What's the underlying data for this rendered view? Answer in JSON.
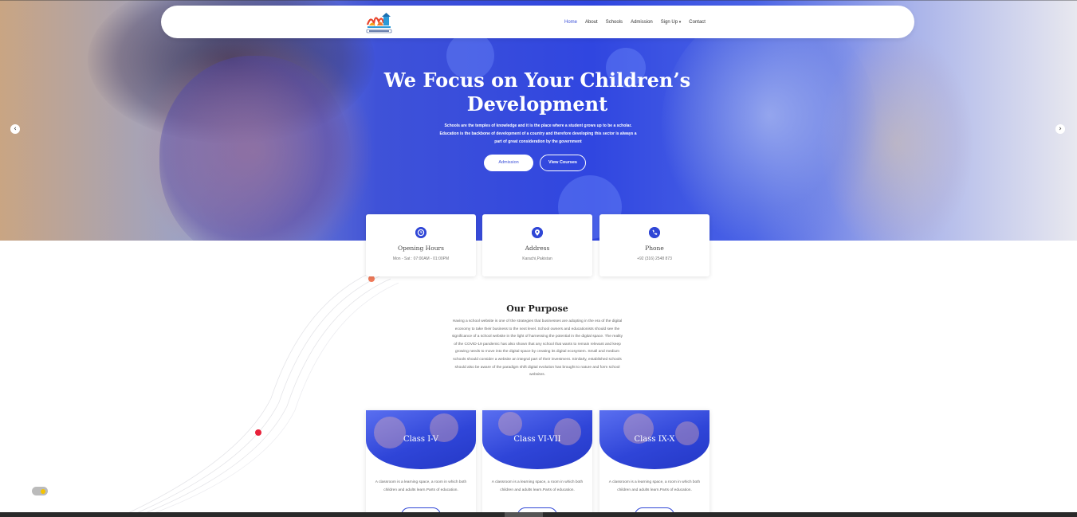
{
  "nav": {
    "items": [
      {
        "label": "Home",
        "active": true
      },
      {
        "label": "About",
        "active": false
      },
      {
        "label": "Schools",
        "active": false
      },
      {
        "label": "Admission",
        "active": false
      },
      {
        "label": "Sign Up",
        "active": false
      },
      {
        "label": "Contact",
        "active": false
      }
    ],
    "signup_caret": "▾"
  },
  "hero": {
    "title": "We Focus on Your Children’s Development",
    "subtitle": "Schools are the temples of knowledge and it is the place where a student grows up to be a scholar. Education is the backbone of development of a country and therefore developing this sector is always a part of great consideration by the government",
    "admission_button": "Admission",
    "courses_button": "View Courses",
    "prev_arrow": "‹",
    "next_arrow": "›"
  },
  "info_cards": [
    {
      "icon": "clock-icon",
      "title": "Opening Hours",
      "text": "Mon - Sat : 07:00AM - 01:00PM"
    },
    {
      "icon": "location-pin-icon",
      "title": "Address",
      "text": "Karachi,Pakistan"
    },
    {
      "icon": "phone-icon",
      "title": "Phone",
      "text": "+92 (316) 2548 873"
    }
  ],
  "purpose": {
    "title": "Our Purpose",
    "text": "Having a school website is one of the strategies that businesses are adopting in the era of the digital economy to take their business to the next level. School owners and educationists should see the significance of a school website in the light of harnessing the potential in the digital space. The reality of the COVID-19 pandemic has also shown that any school that wants to remain relevant and keep growing needs to move into the digital space by creating its digital ecosystem. Small and medium schools should consider a website an integral part of their investment. Similarly, established schools should also be aware of the paradigm shift digital evolution has brought to nature and form school websites."
  },
  "classes": [
    {
      "title": "Class I-V",
      "text": "A classroom is a learning space, a room in which both children and adults learn.Parts of education."
    },
    {
      "title": "Class VI-VII",
      "text": "A classroom is a learning space, a room in which both children and adults learn.Parts of education."
    },
    {
      "title": "Class IX-X",
      "text": "A classroom is a learning space, a room in which both children and adults learn.Parts of education."
    }
  ],
  "colors": {
    "primary": "#2f46d6",
    "accent_orange": "#f07a5a",
    "accent_red": "#e8213a",
    "toggle_knob": "#f5c400"
  }
}
